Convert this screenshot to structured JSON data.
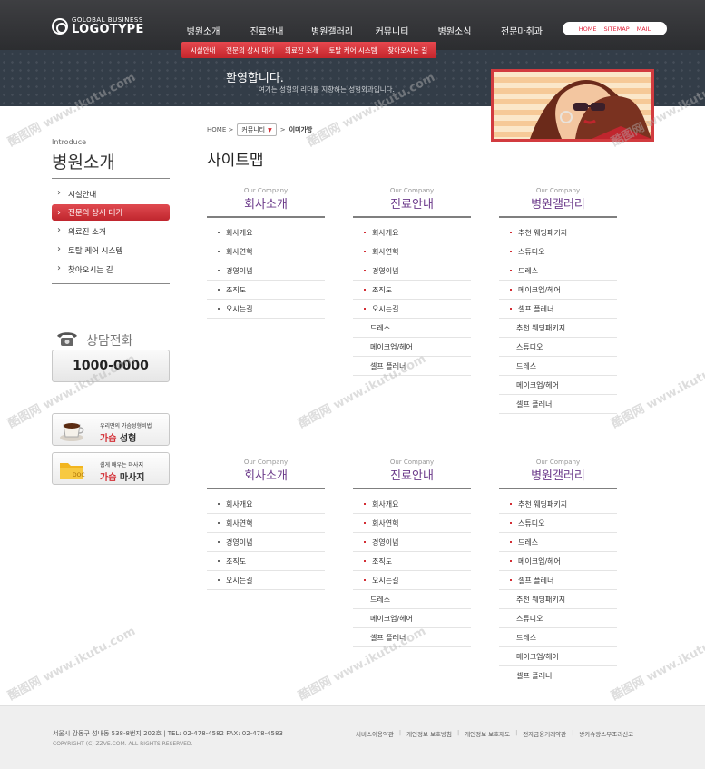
{
  "logo": {
    "small": "GOLOBAL BUSINESS",
    "big": "LOGOTYPE"
  },
  "gnb": [
    "병원소개",
    "진료안내",
    "병원갤러리",
    "커뮤니티",
    "병원소식",
    "전문마취과"
  ],
  "util": [
    "HOME",
    "SITEMAP",
    "MAIL"
  ],
  "subnav": [
    "시설안내",
    "전문의 상시 대기",
    "의료진 소개",
    "토탈 케어 시스템",
    "찾아오시는 길"
  ],
  "visual": {
    "welcome": "환영합니다.",
    "welcome_sub": "여기는 성형의 리더를 지향하는 성형외과입니다."
  },
  "sidebar": {
    "intro_small": "Introduce",
    "intro_title": "병원소개",
    "items": [
      "시설안내",
      "전문의 상시 대기",
      "의료진 소개",
      "토탈 케어 시스템",
      "찾아오시는 길"
    ],
    "active_index": 1,
    "phone_label": "상담전화",
    "phone_number": "1000-0000",
    "promos": [
      {
        "small": "우리만의 가슴성형비법",
        "red": "가슴",
        "rest": " 성형"
      },
      {
        "small": "쉽게 배우는 마사지",
        "red": "가슴",
        "rest": " 마사지"
      }
    ]
  },
  "breadcrumb": {
    "home": "HOME",
    "select": "커뮤니티",
    "current": "이미가방"
  },
  "page_title": "사이트맵",
  "sections": [
    {
      "columns": [
        {
          "sub": "Our Company",
          "title": "회사소개",
          "bullets": [
            "회사개요",
            "회사연혁",
            "경영이념",
            "조직도",
            "오시는길"
          ],
          "plain": []
        },
        {
          "sub": "Our Company",
          "title": "진료안내",
          "bullets": [
            "회사개요",
            "회사연혁",
            "경영이념",
            "조직도",
            "오시는길"
          ],
          "plain": [
            "드레스",
            "메이크업/헤어",
            "셀프 플레너"
          ]
        },
        {
          "sub": "Our Company",
          "title": "병원갤러리",
          "bullets": [
            "추천 웨딩패키지",
            "스튜디오",
            "드레스",
            "메이크업/헤어",
            "셀프 플레너"
          ],
          "plain": [
            "추천 웨딩패키지",
            "스튜디오",
            "드레스",
            "메이크업/헤어",
            "셀프 플레너"
          ]
        }
      ]
    },
    {
      "columns": [
        {
          "sub": "Our Company",
          "title": "회사소개",
          "bullets": [
            "회사개요",
            "회사연혁",
            "경영이념",
            "조직도",
            "오시는길"
          ],
          "plain": []
        },
        {
          "sub": "Our Company",
          "title": "진료안내",
          "bullets": [
            "회사개요",
            "회사연혁",
            "경영이념",
            "조직도",
            "오시는길"
          ],
          "plain": [
            "드레스",
            "메이크업/헤어",
            "셀프 플레너"
          ]
        },
        {
          "sub": "Our Company",
          "title": "병원갤러리",
          "bullets": [
            "추천 웨딩패키지",
            "스튜디오",
            "드레스",
            "메이크업/헤어",
            "셀프 플레너"
          ],
          "plain": [
            "추천 웨딩패키지",
            "스튜디오",
            "드레스",
            "메이크업/헤어",
            "셀프 플레너"
          ]
        }
      ]
    }
  ],
  "footer": {
    "address": "서울시 강동구 성내동 538-8번지 202호 | TEL: 02-478-4582  FAX: 02-478-4583",
    "copyright": "COPYRIGHT (C) ZZVE.COM. ALL RIGHTS RESERVED.",
    "links": [
      "서비스이용약관",
      "개인정보 보호방침",
      "개인정보 보호제도",
      "전자금융거래약관",
      "방카슈랑스부조리신고"
    ]
  },
  "watermark": {
    "cn": "酷图网",
    "url": "www.ikutu.com"
  },
  "colors": {
    "accent_red": "#d32d34",
    "title_purple": "#6b3a8a",
    "header_dark": "#333436"
  }
}
